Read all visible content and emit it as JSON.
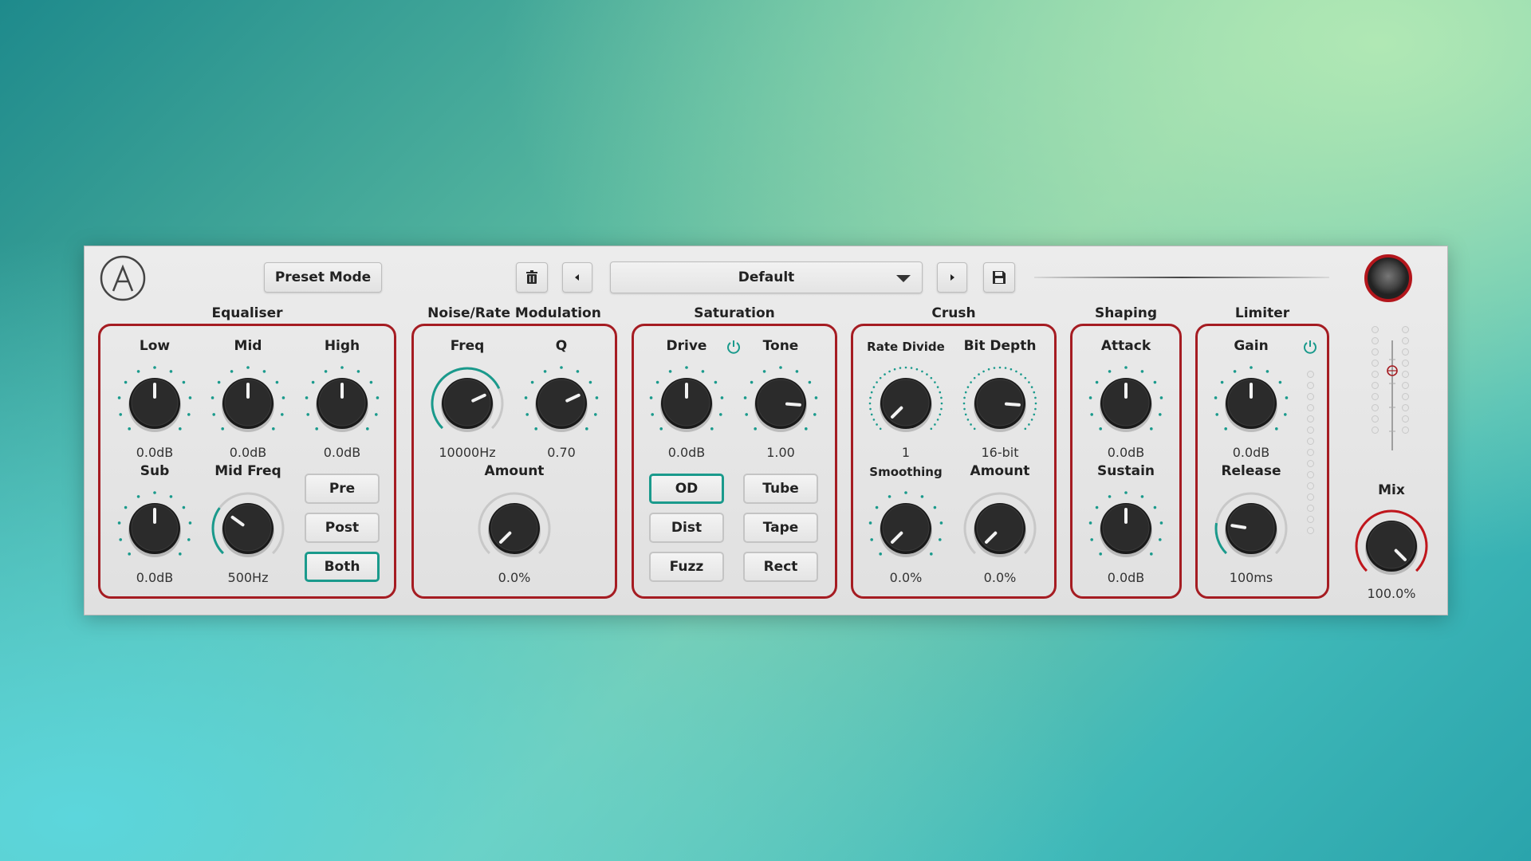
{
  "colors": {
    "accent": "#1a9a8c",
    "section_border": "#a51c22",
    "knob": "#1c1c1c",
    "panel": "#e6e6e6"
  },
  "header": {
    "logo_icon": "circle-a-logo-icon",
    "preset_mode_label": "Preset Mode",
    "delete_icon": "trash-icon",
    "prev_icon": "caret-left-icon",
    "preset_name": "Default",
    "dropdown_icon": "caret-down-icon",
    "next_icon": "caret-right-icon",
    "save_icon": "floppy-disk-icon",
    "avatar_icon": "user-avatar-icon"
  },
  "equaliser": {
    "title": "Equaliser",
    "low": {
      "label": "Low",
      "value": "0.0dB",
      "level": 0.5
    },
    "mid": {
      "label": "Mid",
      "value": "0.0dB",
      "level": 0.5
    },
    "high": {
      "label": "High",
      "value": "0.0dB",
      "level": 0.5
    },
    "sub": {
      "label": "Sub",
      "value": "0.0dB",
      "level": 0.5
    },
    "mid_freq": {
      "label": "Mid Freq",
      "value": "500Hz",
      "level": 0.3
    },
    "buttons": [
      "Pre",
      "Post",
      "Both"
    ],
    "active_button": "Both"
  },
  "noise": {
    "title": "Noise/Rate Modulation",
    "freq": {
      "label": "Freq",
      "value": "10000Hz",
      "level": 0.74
    },
    "q": {
      "label": "Q",
      "value": "0.70",
      "level": 0.74
    },
    "amount": {
      "label": "Amount",
      "value": "0.0%",
      "level": 0.0
    }
  },
  "saturation": {
    "title": "Saturation",
    "power_icon": "power-icon",
    "drive": {
      "label": "Drive",
      "value": "0.0dB",
      "level": 0.5
    },
    "tone": {
      "label": "Tone",
      "value": "1.00",
      "level": 0.85
    },
    "modes": [
      "OD",
      "Tube",
      "Dist",
      "Tape",
      "Fuzz",
      "Rect"
    ],
    "active_mode": "OD"
  },
  "crush": {
    "title": "Crush",
    "rate_divide": {
      "label": "Rate Divide",
      "value": "1",
      "level": 0.0
    },
    "bit_depth": {
      "label": "Bit Depth",
      "value": "16-bit",
      "level": 0.85
    },
    "smoothing": {
      "label": "Smoothing",
      "value": "0.0%",
      "level": 0.0
    },
    "amount": {
      "label": "Amount",
      "value": "0.0%",
      "level": 0.0
    }
  },
  "shaping": {
    "title": "Shaping",
    "attack": {
      "label": "Attack",
      "value": "0.0dB",
      "level": 0.5
    },
    "sustain": {
      "label": "Sustain",
      "value": "0.0dB",
      "level": 0.5
    }
  },
  "limiter": {
    "title": "Limiter",
    "power_icon": "power-icon",
    "gain": {
      "label": "Gain",
      "value": "0.0dB",
      "level": 0.5
    },
    "release": {
      "label": "Release",
      "value": "100ms",
      "level": 0.2
    }
  },
  "mix": {
    "label": "Mix",
    "value": "100.0%",
    "level": 1.0
  }
}
